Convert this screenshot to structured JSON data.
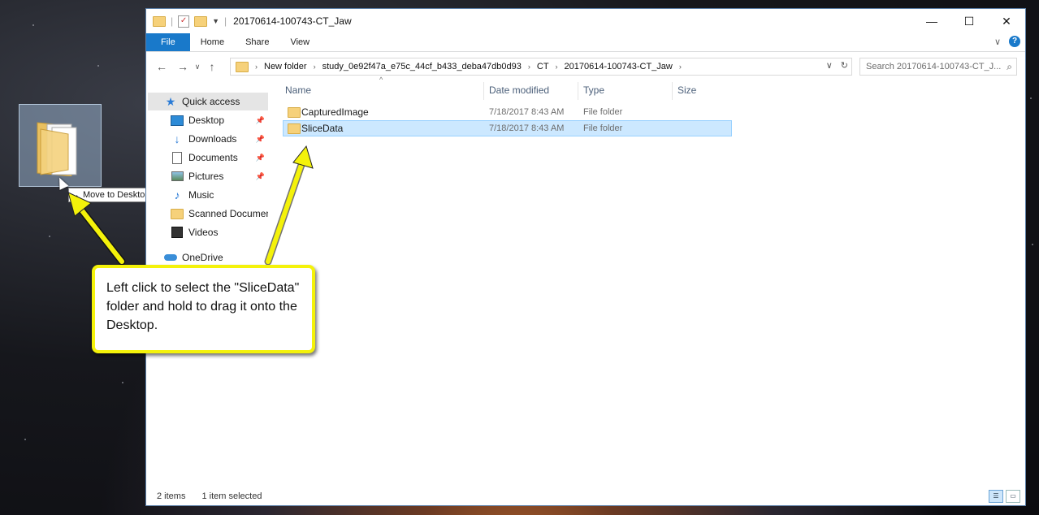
{
  "window": {
    "title": "20170614-100743-CT_Jaw",
    "controls": {
      "minimize": "—",
      "maximize": "☐",
      "close": "✕"
    }
  },
  "ribbon": {
    "tabs": [
      "File",
      "Home",
      "Share",
      "View"
    ],
    "help": "?"
  },
  "address": {
    "crumbs": [
      "New folder",
      "study_0e92f47a_e75c_44cf_b433_deba47db0d93",
      "CT",
      "20170614-100743-CT_Jaw"
    ],
    "search_placeholder": "Search 20170614-100743-CT_J..."
  },
  "nav": {
    "items": [
      {
        "label": "Quick access",
        "icon": "star-icon",
        "pinned": false
      },
      {
        "label": "Desktop",
        "icon": "desktop-icon",
        "pinned": true
      },
      {
        "label": "Downloads",
        "icon": "download-icon",
        "pinned": true
      },
      {
        "label": "Documents",
        "icon": "document-icon",
        "pinned": true
      },
      {
        "label": "Pictures",
        "icon": "pictures-icon",
        "pinned": true
      },
      {
        "label": "Music",
        "icon": "music-icon",
        "pinned": false
      },
      {
        "label": "Scanned Documents",
        "icon": "folder-icon",
        "pinned": false
      },
      {
        "label": "Videos",
        "icon": "videos-icon",
        "pinned": false
      },
      {
        "label": "OneDrive",
        "icon": "cloud-icon",
        "pinned": false
      }
    ]
  },
  "columns": {
    "name": "Name",
    "date": "Date modified",
    "type": "Type",
    "size": "Size"
  },
  "files": [
    {
      "name": "CapturedImage",
      "date": "7/18/2017 8:43 AM",
      "type": "File folder",
      "selected": false
    },
    {
      "name": "SliceData",
      "date": "7/18/2017 8:43 AM",
      "type": "File folder",
      "selected": true
    }
  ],
  "status": {
    "count": "2 items",
    "selection": "1 item selected"
  },
  "drag": {
    "tooltip": "Move to Desktop"
  },
  "callout": {
    "text": "Left click to select the \"SliceData\" folder and hold to drag it onto the Desktop."
  },
  "colors": {
    "accent": "#1979ca",
    "selection": "#cce8ff",
    "callout_border": "#f4f20a"
  }
}
